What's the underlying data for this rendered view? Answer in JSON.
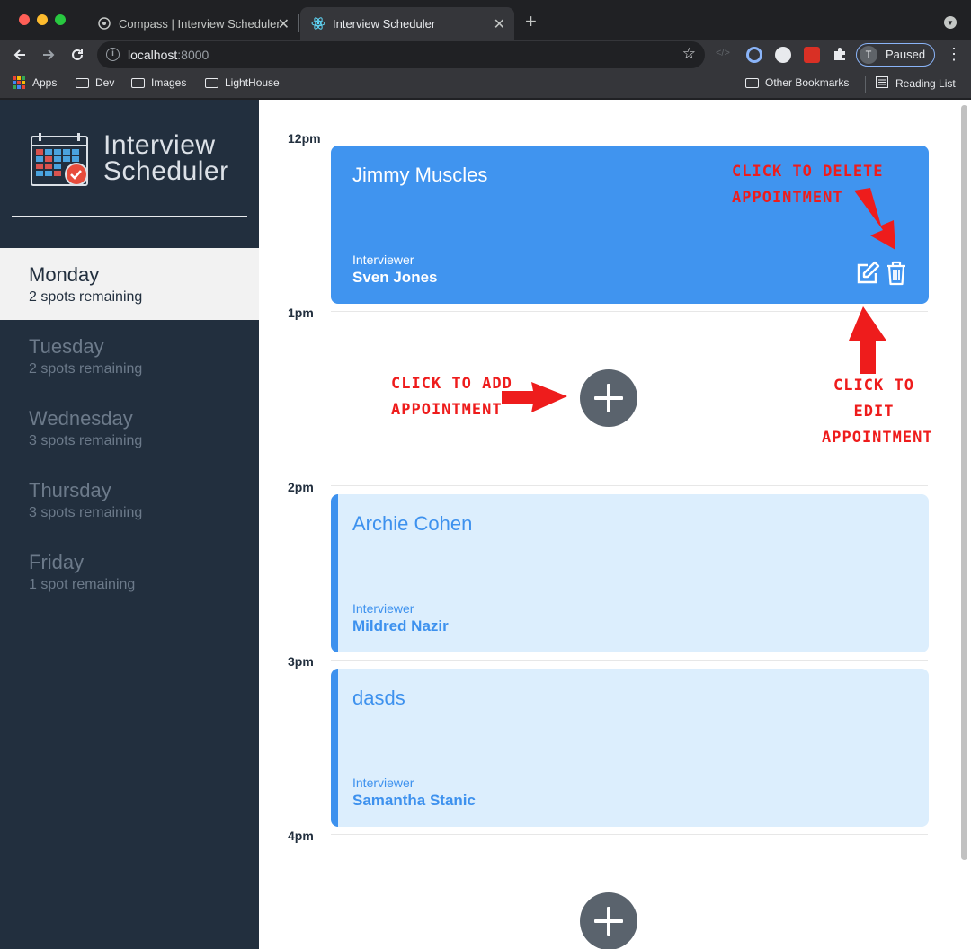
{
  "browser": {
    "tabs": [
      {
        "title": "Compass | Interview Scheduler",
        "close": "✕"
      },
      {
        "title": "Interview Scheduler",
        "close": "✕"
      }
    ],
    "new_tab": "+",
    "url_host": "localhost",
    "url_port": ":8000",
    "profile_initial": "T",
    "profile_status": "Paused",
    "bookmarks": [
      "Apps",
      "Dev",
      "Images",
      "LightHouse"
    ],
    "bookmarks_right": [
      "Other Bookmarks",
      "Reading List"
    ]
  },
  "sidebar": {
    "title_line1": "Interview",
    "title_line2": "Scheduler",
    "days": [
      {
        "name": "Monday",
        "spots": "2 spots remaining",
        "selected": true
      },
      {
        "name": "Tuesday",
        "spots": "2 spots remaining"
      },
      {
        "name": "Wednesday",
        "spots": "3 spots remaining"
      },
      {
        "name": "Thursday",
        "spots": "3 spots remaining"
      },
      {
        "name": "Friday",
        "spots": "1 spot remaining"
      }
    ]
  },
  "schedule": {
    "hours": [
      "12pm",
      "1pm",
      "2pm",
      "3pm",
      "4pm"
    ],
    "appointments": [
      {
        "student": "Jimmy Muscles",
        "interviewer_label": "Interviewer",
        "interviewer": "Sven Jones"
      },
      {
        "student": "Archie Cohen",
        "interviewer_label": "Interviewer",
        "interviewer": "Mildred Nazir"
      },
      {
        "student": "dasds",
        "interviewer_label": "Interviewer",
        "interviewer": "Samantha Stanic"
      }
    ]
  },
  "annotations": {
    "delete_line1": "CLICK TO DELETE",
    "delete_line2": "APPOINTMENT",
    "add_line1": "CLICK TO ADD",
    "add_line2": "APPOINTMENT",
    "edit_line1": "CLICK TO",
    "edit_line2": "EDIT",
    "edit_line3": "APPOINTMENT"
  },
  "colors": {
    "sidebar_bg": "#222f3e",
    "selected_day_bg": "#f2f2f2",
    "accent_blue": "#4094ef",
    "booked_bg": "#dceefd",
    "add_button": "#5a636d",
    "annotation_red": "#ee1c1c"
  }
}
